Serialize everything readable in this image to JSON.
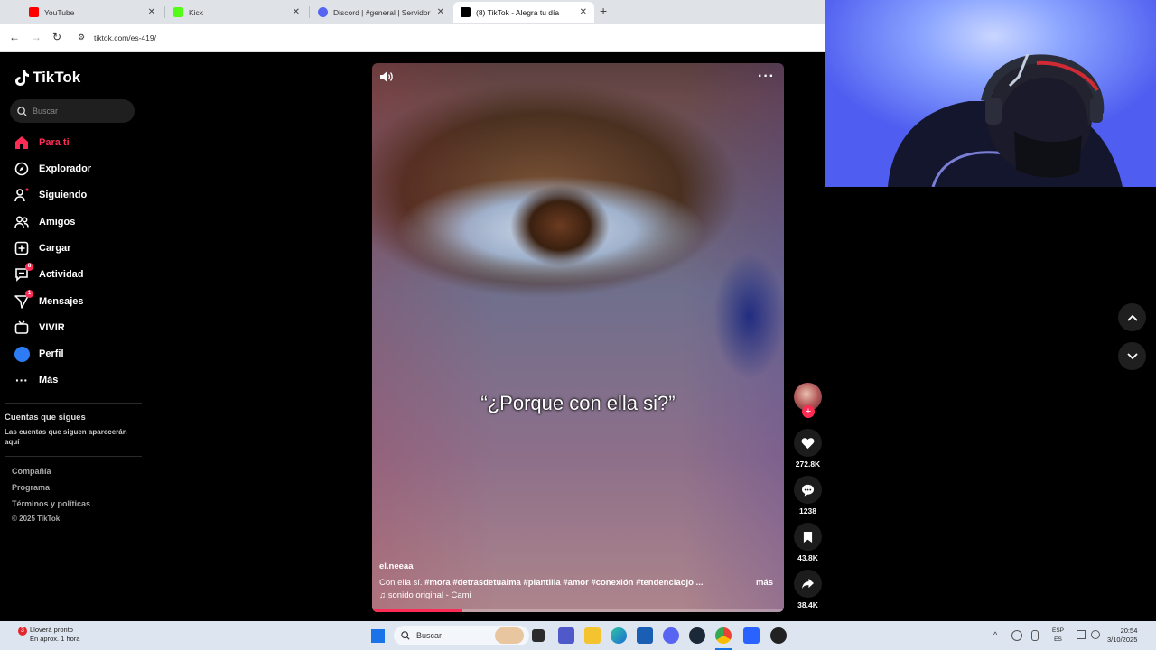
{
  "browser": {
    "tabs": [
      {
        "title": "YouTube",
        "color": "#ff0000"
      },
      {
        "title": "Kick",
        "color": "#53fc18"
      },
      {
        "title": "Discord | #general | Servidor de",
        "color": "#5865f2"
      },
      {
        "title": "(8) TikTok - Alegra tu día",
        "color": "#000000"
      }
    ],
    "url": "tiktok.com/es-419/"
  },
  "sidebar": {
    "logo": "TikTok",
    "search_placeholder": "Buscar",
    "items": [
      {
        "label": "Para ti",
        "icon": "home-icon",
        "active": true
      },
      {
        "label": "Explorador",
        "icon": "compass-icon"
      },
      {
        "label": "Siguiendo",
        "icon": "following-icon"
      },
      {
        "label": "Amigos",
        "icon": "friends-icon"
      },
      {
        "label": "Cargar",
        "icon": "upload-icon"
      },
      {
        "label": "Actividad",
        "icon": "activity-icon",
        "badge": "8"
      },
      {
        "label": "Mensajes",
        "icon": "messages-icon",
        "badge": "1"
      },
      {
        "label": "VIVIR",
        "icon": "live-icon"
      },
      {
        "label": "Perfil",
        "icon": "profile-avatar"
      },
      {
        "label": "Más",
        "icon": "more-icon"
      }
    ],
    "following_title": "Cuentas que sigues",
    "following_subtitle": "Las cuentas que siguen aparecerán aquí",
    "footer": [
      "Compañía",
      "Programa",
      "Términos y políticas"
    ],
    "copyright": "© 2025 TikTok"
  },
  "video": {
    "overlay_text": "“¿Porque con ella si?”",
    "author": "el.neeaa",
    "description_prefix": "Con ella sí. ",
    "hashtags": "#mora  #detrasdetualma  #plantilla  #amor  #conexión  #tendenciaojo ...",
    "more": "más",
    "sound": "♫ sonido original - Cami",
    "progress": 0.22
  },
  "actions": {
    "likes": "272.8K",
    "comments": "1238",
    "saves": "43.8K",
    "shares": "38.4K"
  },
  "taskbar": {
    "weather_line1": "Lloverá pronto",
    "weather_line2": "En aprox. 1 hora",
    "search": "Buscar",
    "lang1": "ESP",
    "lang2": "ES",
    "time": "20:54",
    "date": "3/10/2025"
  }
}
